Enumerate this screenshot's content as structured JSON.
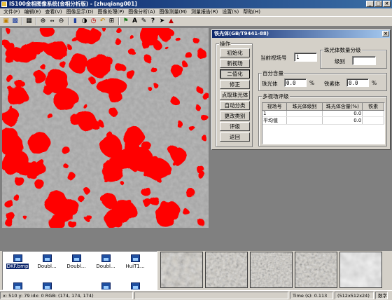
{
  "window": {
    "title": "IS100金相图像系统(金相分析版) - [zhuqiang001]",
    "controls": [
      "_",
      "□",
      "×"
    ]
  },
  "menu": [
    "文件(F)",
    "编辑(E)",
    "查看(V)",
    "图像显示(D)",
    "图像处理(P)",
    "图像分析(A)",
    "图像测量(M)",
    "测量报告(R)",
    "设置(S)",
    "帮助(H)"
  ],
  "toolbar": {
    "icons": [
      "open-icon",
      "save-icon",
      "print-icon",
      "zoom-in-icon",
      "zoom-fit-icon",
      "zoom-out-icon",
      "camera-icon",
      "capture-icon",
      "clock-icon",
      "rotate-icon",
      "crop-icon",
      "tag-icon",
      "text-icon",
      "pen-icon",
      "help-icon",
      "arrow-icon",
      "report-icon"
    ]
  },
  "dialog": {
    "title": "铁光体(GB/T9441-88)",
    "ops_group": "操作",
    "buttons": [
      "初始化",
      "新视场",
      "二值化",
      "修正",
      "点取珠光体",
      "自动分类",
      "更改类别",
      "评级",
      "返回"
    ],
    "active_button_index": 2,
    "current_field_label": "当前视场号",
    "current_field_value": "1",
    "pearlite_group": "珠光体数量分级",
    "grade_label": "级别",
    "grade_value": "",
    "percent_group": "百分含量",
    "pearlite_label": "珠光体",
    "pearlite_value": "0.0",
    "ferrite_label": "铁素体",
    "ferrite_value": "0.0",
    "percent_unit": "%",
    "multi_group": "多视场评级",
    "table_headers": [
      "视场号",
      "珠光体级别",
      "珠光体含量(%)",
      "铁素"
    ],
    "table_rows": [
      [
        "1",
        "",
        "0.0",
        ""
      ],
      [
        "平均值",
        "",
        "0.0",
        ""
      ]
    ]
  },
  "files": [
    {
      "name": "DKF.bmp",
      "selected": true
    },
    {
      "name": "Doubl...",
      "selected": false
    },
    {
      "name": "Doubl...",
      "selected": false
    },
    {
      "name": "Doubl...",
      "selected": false
    },
    {
      "name": "HuiT1...",
      "selected": false
    },
    {
      "name": "",
      "selected": false
    },
    {
      "name": "",
      "selected": false
    },
    {
      "name": "",
      "selected": false
    },
    {
      "name": "",
      "selected": false
    }
  ],
  "status": {
    "coords": "x: 510 y: 79 idx: 0 RGB: (174, 174, 174)",
    "time": "Time (s): 0.113",
    "size": "(512x512x24)",
    "mode": "数字"
  },
  "colors": {
    "phase": "#ff0000",
    "matrix": "#a8a8a8",
    "titlebar": "#0a246a"
  }
}
